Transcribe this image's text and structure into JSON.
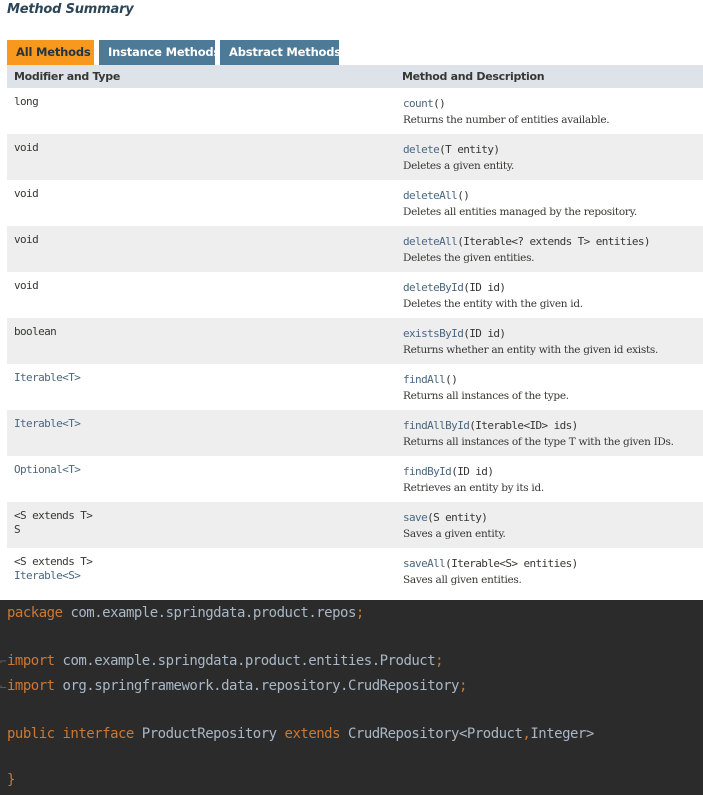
{
  "javadoc": {
    "section_title": "Method Summary",
    "tabs": [
      {
        "label": "All Methods",
        "active": true
      },
      {
        "label": "Instance Methods",
        "active": false
      },
      {
        "label": "Abstract Methods",
        "active": false
      }
    ],
    "headers": {
      "col1": "Modifier and Type",
      "col2": "Method and Description"
    },
    "rows": [
      {
        "modifier": [
          "long"
        ],
        "method_name": "count",
        "method_params": "()",
        "description": "Returns the number of entities available."
      },
      {
        "modifier": [
          "void"
        ],
        "method_name": "delete",
        "method_params": "(T entity)",
        "description": "Deletes a given entity."
      },
      {
        "modifier": [
          "void"
        ],
        "method_name": "deleteAll",
        "method_params": "()",
        "description": "Deletes all entities managed by the repository."
      },
      {
        "modifier": [
          "void"
        ],
        "method_name": "deleteAll",
        "method_params": "(Iterable<? extends T> entities)",
        "description": "Deletes the given entities."
      },
      {
        "modifier": [
          "void"
        ],
        "method_name": "deleteById",
        "method_params": "(ID id)",
        "description": "Deletes the entity with the given id."
      },
      {
        "modifier": [
          "boolean"
        ],
        "method_name": "existsById",
        "method_params": "(ID id)",
        "description": "Returns whether an entity with the given id exists."
      },
      {
        "modifier": [
          "Iterable<T>"
        ],
        "method_name": "findAll",
        "method_params": "()",
        "description": "Returns all instances of the type."
      },
      {
        "modifier": [
          "Iterable<T>"
        ],
        "method_name": "findAllById",
        "method_params": "(Iterable<ID> ids)",
        "description": "Returns all instances of the type T with the given IDs."
      },
      {
        "modifier": [
          "Optional<T>"
        ],
        "method_name": "findById",
        "method_params": "(ID id)",
        "description": "Retrieves an entity by its id."
      },
      {
        "modifier": [
          "<S extends T>",
          "S"
        ],
        "method_name": "save",
        "method_params": "(S entity)",
        "description": "Saves a given entity."
      },
      {
        "modifier": [
          "<S extends T>",
          "Iterable<S>"
        ],
        "method_name": "saveAll",
        "method_params": "(Iterable<S> entities)",
        "description": "Saves all given entities."
      }
    ]
  },
  "code": {
    "line1": {
      "kw": "package",
      "rest": "com.example.springdata.product.repos",
      "end": ";"
    },
    "line2": {
      "kw": "import",
      "rest": "com.example.springdata.product.entities.Product",
      "end": ";"
    },
    "line3": {
      "kw": "import",
      "rest": "org.springframework.data.repository.CrudRepository",
      "end": ";"
    },
    "line4": {
      "kw1": "public interface",
      "name": "ProductRepository",
      "kw2": "extends",
      "type_pre": "CrudRepository<Product",
      "comma": ",",
      "type_post": "Integer>"
    },
    "line5": {
      "brace": "}"
    }
  },
  "colors": {
    "tab_active": "#f8981d",
    "tab_inactive": "#4d7a97",
    "header_bg": "#dee3e9",
    "row_alt": "#eeeeef",
    "link": "#4a6782",
    "code_bg": "#2b2b2b",
    "code_keyword": "#cc7832",
    "code_text": "#a9b7c6"
  }
}
